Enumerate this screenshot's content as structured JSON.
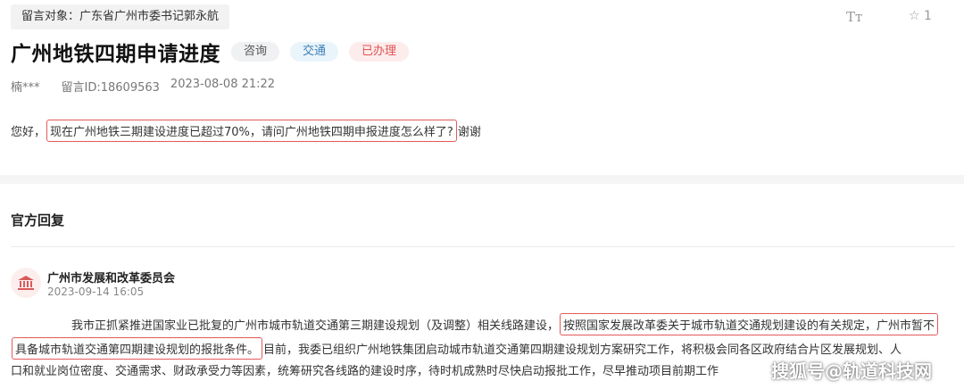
{
  "header": {
    "target_label": "留言对象：广东省广州市委书记郭永航",
    "font_tool_icon": "Tт",
    "star_count": "1"
  },
  "post": {
    "title": "广州地铁四期申请进度",
    "tags": [
      "咨询",
      "交通",
      "已办理"
    ],
    "author": "楠***",
    "message_id": "留言ID:18609563",
    "datetime": "2023-08-08 21:22",
    "question_pre": "您好，",
    "question_highlight": "现在广州地铁三期建设进度已超过70%，请问广州地铁四期申报进度怎么样了?",
    "question_post": "谢谢"
  },
  "reply": {
    "section_title": "官方回复",
    "org_name": "广州市发展和改革委员会",
    "org_time": "2023-09-14 16:05",
    "line1_pre": "我市正抓紧推进国家业已批复的广州市城市轨道交通第三期建设规划（及调整）相关线路建设，",
    "line1_highlight": "按照国家发展改革委关于城市轨道交通规划建设的有关规定，广州市暂不",
    "line2_highlight": "具备城市轨道交通第四期建设规划的报批条件。",
    "line2_post": "目前，我委已组织广州地铁集团启动城市轨道交通第四期建设规划方案研究工作，将积极会同各区政府结合片区发展规划、人",
    "line3": "口和就业岗位密度、交通需求、财政承受力等因素，统筹研究各线路的建设时序，待时机成熟时尽快启动报批工作，尽早推动项目前期工作"
  },
  "watermark": "搜狐号@轨道科技网",
  "colors": {
    "highlight_border": "#e35a5a",
    "badge_grey": "#f0f1f3",
    "badge_blue": "#eaf4fb",
    "badge_red": "#fdecec"
  }
}
